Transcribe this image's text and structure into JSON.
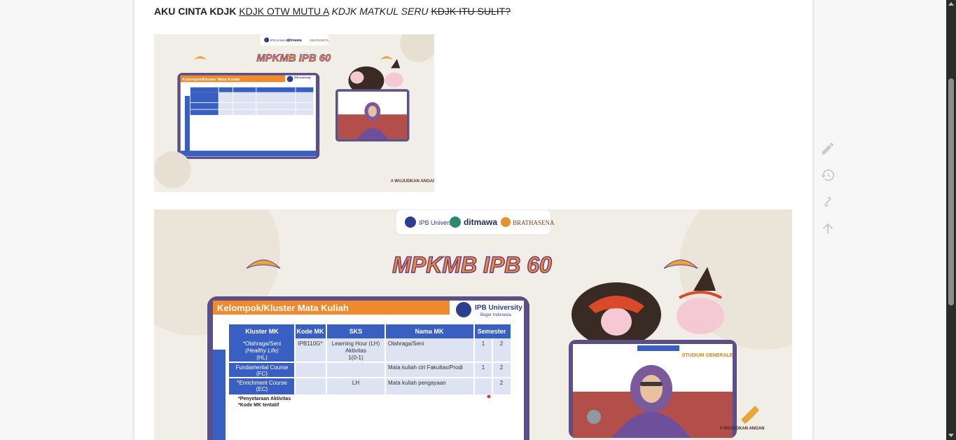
{
  "post": {
    "text": {
      "bold": "AKU CINTA KDJK",
      "underline": "KDJK OTW MUTU A",
      "italic": "KDJK MATKUL SERU",
      "strike": "KDJK ITU SULIT?"
    },
    "image": {
      "logos": [
        "IPB University",
        "ditmawa",
        "BRATHASENA"
      ],
      "title": "MPKMB IPB 60",
      "slide_title": "Kelompok/Kluster Mata Kuliah",
      "slide_logo": "IPB University",
      "slide_logo_sub": "Bogor Indonesia",
      "table_headers": [
        "Kluster MK",
        "Kode MK",
        "SKS",
        "Nama MK",
        "Semester"
      ],
      "table_rows": [
        [
          "*Olahraga/Seni (Healthy Life) (HL)",
          "IPB110G*",
          "Learning Hour (LH) Aktivitas 1(0-1)",
          "Olahraga/Seni",
          "1",
          "2"
        ],
        [
          "Fundamental Course (FC)",
          "",
          "",
          "Mata kuliah ciri Fakultas/Prodi",
          "1",
          "2"
        ],
        [
          "*Enrichment Course (EC)",
          "",
          "LH",
          "Mata kuliah pengayaan",
          "",
          "2"
        ]
      ],
      "notes": [
        "*Penyetaraan Aktivitas",
        "*Kode MK tentatif"
      ],
      "hashtag": "# WUJUDKAN ANGAN",
      "video_badge": "STUDIUM GENERALE"
    }
  },
  "side_tools": [
    {
      "name": "edit-icon"
    },
    {
      "name": "history-icon"
    },
    {
      "name": "link-icon"
    },
    {
      "name": "arrow-up-icon"
    }
  ],
  "colors": {
    "slide_header": "#f08a2c",
    "slide_frame": "#5c4f86",
    "table_header": "#3a5fc2",
    "title_orange": "#f0902c"
  }
}
